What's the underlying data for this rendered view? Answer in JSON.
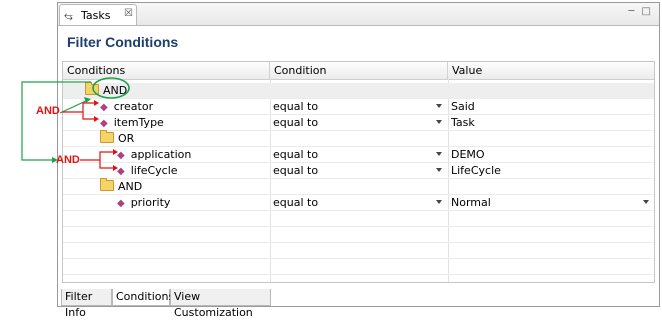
{
  "tab": {
    "label": "Tasks",
    "close": "☒",
    "icon": "⥃"
  },
  "window_buttons": "─ □",
  "title": "Filter Conditions",
  "columns": {
    "conditions": "Conditions",
    "condition": "Condition",
    "value": "Value"
  },
  "rows": [
    {
      "label": "AND",
      "type": "group",
      "condition": "",
      "value": ""
    },
    {
      "label": "creator",
      "type": "condition",
      "condition": "equal to",
      "value": "Said"
    },
    {
      "label": "itemType",
      "type": "condition",
      "condition": "equal to",
      "value": "Task"
    },
    {
      "label": "OR",
      "type": "group",
      "condition": "",
      "value": ""
    },
    {
      "label": "application",
      "type": "condition",
      "condition": "equal to",
      "value": "DEMO"
    },
    {
      "label": "lifeCycle",
      "type": "condition",
      "condition": "equal to",
      "value": "LifeCycle"
    },
    {
      "label": "AND",
      "type": "group",
      "condition": "",
      "value": ""
    },
    {
      "label": "priority",
      "type": "condition",
      "condition": "equal to",
      "value": "Normal"
    }
  ],
  "bottom_tabs": [
    "Filter Info",
    "Conditions",
    "View Customization"
  ],
  "annotations": {
    "and1": "AND",
    "and2": "AND"
  },
  "colors": {
    "title": "#1d3e6e",
    "annotation_red": "#e01414",
    "annotation_green": "#1aa34a",
    "diamond": "#b0407f"
  }
}
